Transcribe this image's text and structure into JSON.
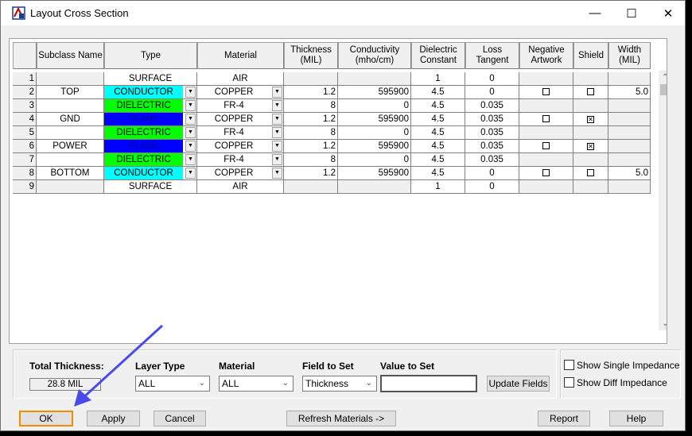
{
  "window": {
    "title": "Layout Cross Section",
    "minimize": "—",
    "maximize": "☐",
    "close": "✕"
  },
  "columns": [
    "Subclass Name",
    "Type",
    "Material",
    "Thickness\n(MIL)",
    "Conductivity\n(mho/cm)",
    "Dielectric\nConstant",
    "Loss\nTangent",
    "Negative\nArtwork",
    "Shield",
    "Width\n(MIL)"
  ],
  "rows": [
    {
      "num": "1",
      "name": "",
      "type": "SURFACE",
      "type_color": "#ffffff",
      "type_text_color": "#000000",
      "type_dd": false,
      "material": "AIR",
      "material_dd": false,
      "thickness": "",
      "conductivity": "",
      "dielectric": "1",
      "loss": "0",
      "negative": "",
      "shield": "",
      "width": "",
      "gray": true
    },
    {
      "num": "2",
      "name": "TOP",
      "type": "CONDUCTOR",
      "type_color": "#00ffff",
      "type_text_color": "#000000",
      "type_dd": true,
      "material": "COPPER",
      "material_dd": true,
      "thickness": "1.2",
      "conductivity": "595900",
      "dielectric": "4.5",
      "loss": "0",
      "negative": "off",
      "shield": "",
      "width": "5.0",
      "gray": false
    },
    {
      "num": "3",
      "name": "",
      "type": "DIELECTRIC",
      "type_color": "#00ff00",
      "type_text_color": "#000000",
      "type_dd": true,
      "material": "FR-4",
      "material_dd": true,
      "thickness": "8",
      "conductivity": "0",
      "dielectric": "4.5",
      "loss": "0.035",
      "negative": "",
      "shield": "",
      "width": "",
      "gray": false
    },
    {
      "num": "4",
      "name": "GND",
      "type": "PLANE",
      "type_color": "#0000ff",
      "type_text_color": "#0000aa",
      "type_dd": true,
      "material": "COPPER",
      "material_dd": true,
      "thickness": "1.2",
      "conductivity": "595900",
      "dielectric": "4.5",
      "loss": "0.035",
      "negative": "off",
      "shield": "on",
      "width": "",
      "gray": false
    },
    {
      "num": "5",
      "name": "",
      "type": "DIELECTRIC",
      "type_color": "#00ff00",
      "type_text_color": "#000000",
      "type_dd": true,
      "material": "FR-4",
      "material_dd": true,
      "thickness": "8",
      "conductivity": "0",
      "dielectric": "4.5",
      "loss": "0.035",
      "negative": "",
      "shield": "",
      "width": "",
      "gray": false
    },
    {
      "num": "6",
      "name": "POWER",
      "type": "PLANE",
      "type_color": "#0000ff",
      "type_text_color": "#0000aa",
      "type_dd": true,
      "material": "COPPER",
      "material_dd": true,
      "thickness": "1.2",
      "conductivity": "595900",
      "dielectric": "4.5",
      "loss": "0.035",
      "negative": "off",
      "shield": "on",
      "width": "",
      "gray": false
    },
    {
      "num": "7",
      "name": "",
      "type": "DIELECTRIC",
      "type_color": "#00ff00",
      "type_text_color": "#000000",
      "type_dd": true,
      "material": "FR-4",
      "material_dd": true,
      "thickness": "8",
      "conductivity": "0",
      "dielectric": "4.5",
      "loss": "0.035",
      "negative": "",
      "shield": "",
      "width": "",
      "gray": false
    },
    {
      "num": "8",
      "name": "BOTTOM",
      "type": "CONDUCTOR",
      "type_color": "#00ffff",
      "type_text_color": "#000000",
      "type_dd": true,
      "material": "COPPER",
      "material_dd": true,
      "thickness": "1.2",
      "conductivity": "595900",
      "dielectric": "4.5",
      "loss": "0",
      "negative": "off",
      "shield": "",
      "width": "5.0",
      "gray": false
    },
    {
      "num": "9",
      "name": "",
      "type": "SURFACE",
      "type_color": "#ffffff",
      "type_text_color": "#000000",
      "type_dd": false,
      "material": "AIR",
      "material_dd": false,
      "thickness": "",
      "conductivity": "",
      "dielectric": "1",
      "loss": "0",
      "negative": "",
      "shield": "",
      "width": "",
      "gray": true
    }
  ],
  "scroll": {
    "up": "⌃",
    "down": "⌄",
    "left": "<",
    "right": ">"
  },
  "total_thickness": {
    "label": "Total Thickness:",
    "value": "28.8 MIL"
  },
  "layer_type": {
    "label": "Layer Type",
    "value": "ALL"
  },
  "material": {
    "label": "Material",
    "value": "ALL"
  },
  "field_to_set": {
    "label": "Field to Set",
    "value": "Thickness"
  },
  "value_to_set": {
    "label": "Value to Set",
    "value": ""
  },
  "buttons": {
    "update_fields": "Update Fields",
    "ok": "OK",
    "apply": "Apply",
    "cancel": "Cancel",
    "refresh_materials": "Refresh Materials ->",
    "report": "Report",
    "help": "Help"
  },
  "options": {
    "show_single_impedance": "Show Single Impedance",
    "show_diff_impedance": "Show Diff Impedance"
  },
  "colors": {
    "accent": "#f08c00",
    "arrow": "#4a4ae8"
  }
}
